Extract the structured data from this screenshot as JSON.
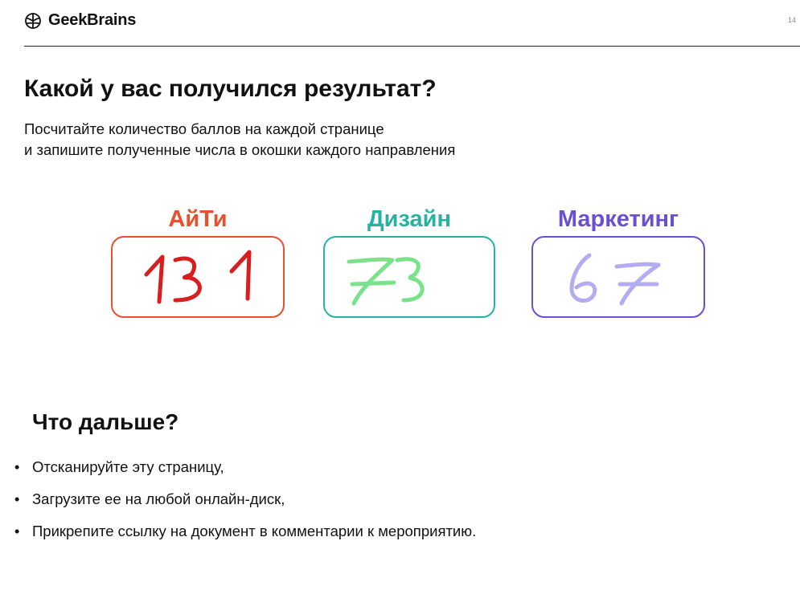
{
  "header": {
    "logo_text": "GeekBrains",
    "page_number": "14"
  },
  "title": "Какой у вас получился результат?",
  "subtitle": {
    "line1": "Посчитайте количество баллов на каждой странице",
    "line2": "и запишите полученные числа в окошки каждого направления"
  },
  "cards": [
    {
      "label": "АйТи",
      "color": "#e8502e",
      "score": "131",
      "ink_color": "#d81e1e"
    },
    {
      "label": "Дизайн",
      "color": "#26b3a4",
      "score": "73",
      "ink_color": "#7ae38a"
    },
    {
      "label": "Маркетинг",
      "color": "#6a4fd1",
      "score": "67",
      "ink_color": "#b3acf0"
    }
  ],
  "next": {
    "title": "Что дальше?",
    "items": [
      "Отсканируйте эту страницу,",
      "Загрузите ее на любой онлайн-диск,",
      "Прикрепите ссылку на документ в комментарии к мероприятию."
    ]
  }
}
